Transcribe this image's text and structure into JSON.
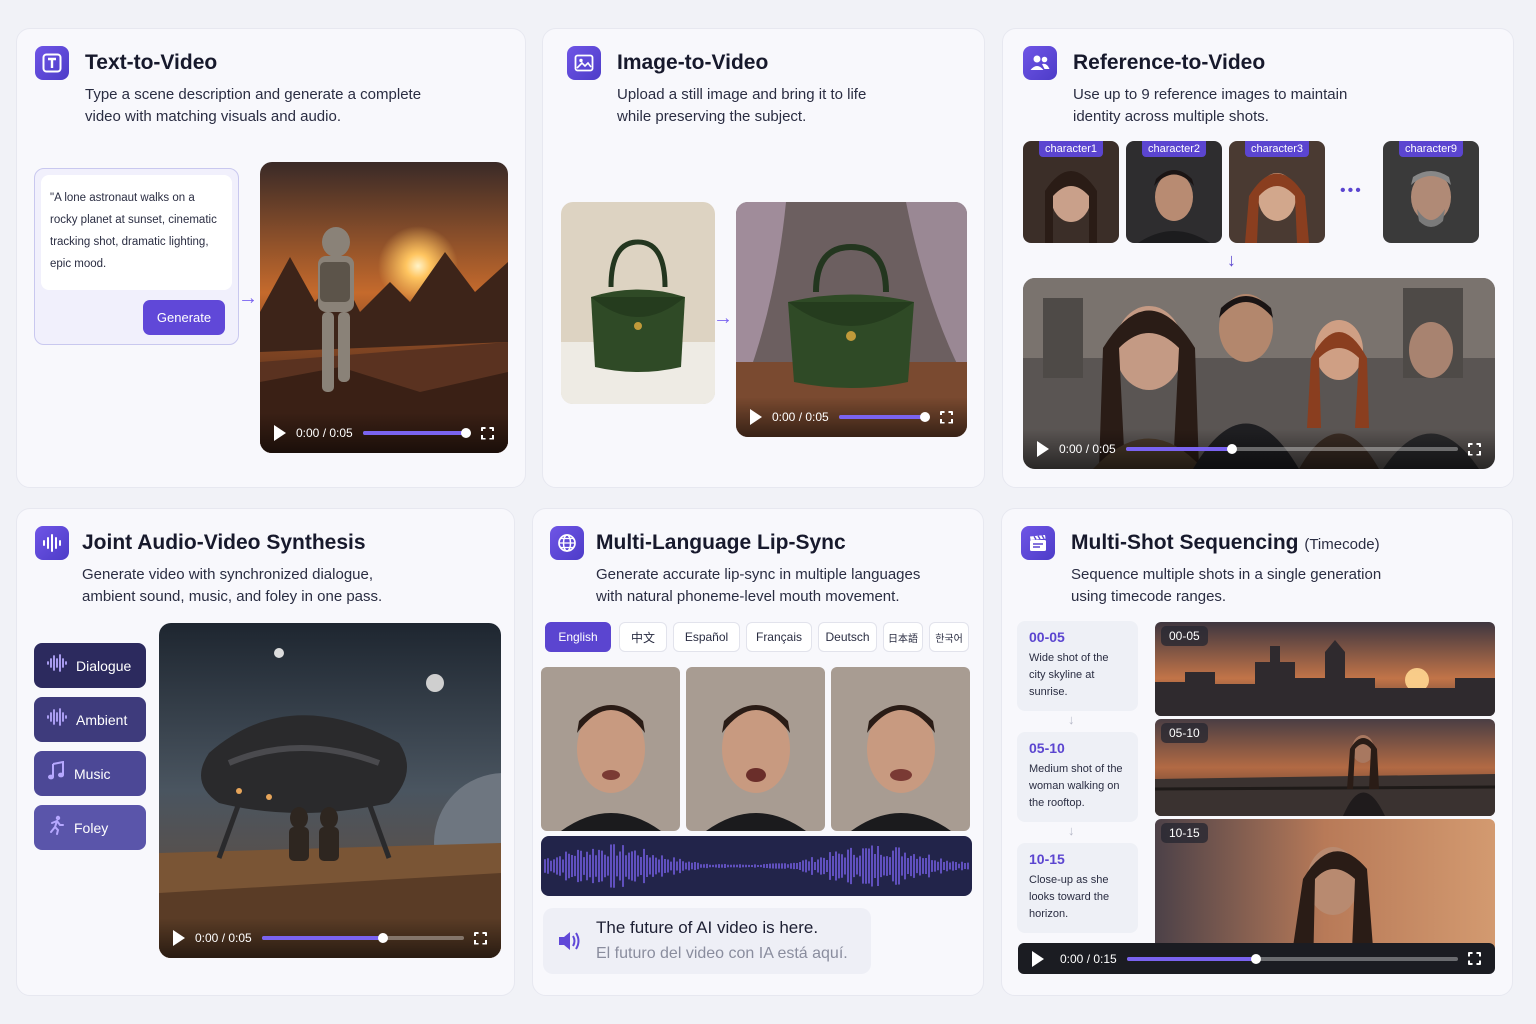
{
  "colors": {
    "accent": "#5b45d0",
    "accent_light": "#7a63f0",
    "card_bg": "#f8f8fc",
    "page_bg": "#f1f2f7"
  },
  "text_to_video": {
    "title": "Text-to-Video",
    "desc_1": "Type a scene description and generate a complete",
    "desc_2": "video with matching visuals and audio.",
    "prompt": "\"A lone astronaut walks on a rocky planet at sunset, cinematic tracking shot, dramatic lighting, epic mood.",
    "generate_label": "Generate",
    "player": {
      "time": "0:00 / 0:05",
      "progress": 0.95
    }
  },
  "image_to_video": {
    "title": "Image-to-Video",
    "desc_1": "Upload a still image and bring it to life",
    "desc_2": "while preserving the subject.",
    "player": {
      "time": "0:00 / 0:05",
      "progress": 0.95
    }
  },
  "reference_to_video": {
    "title": "Reference-to-Video",
    "desc_1": "Use up to 9 reference images to maintain",
    "desc_2": "identity across multiple shots.",
    "characters": [
      "character1",
      "character2",
      "character3",
      "character9"
    ],
    "ellipsis": "•••",
    "player": {
      "time": "0:00 / 0:05",
      "progress": 0.32
    }
  },
  "joint_audio": {
    "title": "Joint Audio-Video Synthesis",
    "desc_1": "Generate video with synchronized dialogue,",
    "desc_2": "ambient sound, music, and foley in one pass.",
    "buttons": [
      {
        "label": "Dialogue",
        "icon": "waveform-icon"
      },
      {
        "label": "Ambient",
        "icon": "waveform-icon"
      },
      {
        "label": "Music",
        "icon": "music-note-icon"
      },
      {
        "label": "Foley",
        "icon": "running-figure-icon"
      }
    ],
    "player": {
      "time": "0:00 / 0:05",
      "progress": 0.6
    }
  },
  "lip_sync": {
    "title": "Multi-Language Lip-Sync",
    "desc_1": "Generate accurate lip-sync in multiple languages",
    "desc_2": "with natural phoneme-level mouth movement.",
    "languages": [
      "English",
      "中文",
      "Español",
      "Français",
      "Deutsch",
      "日本語",
      "한국어"
    ],
    "active_language": "English",
    "line_1": "The future of AI video is here.",
    "line_2": "El futuro del video con IA está aquí."
  },
  "multi_shot": {
    "title": "Multi-Shot Sequencing",
    "title_sub": "(Timecode)",
    "desc_1": "Sequence multiple shots in a single generation",
    "desc_2": "using timecode ranges.",
    "shots": [
      {
        "tc": "00-05",
        "desc": "Wide shot of the city skyline at sunrise."
      },
      {
        "tc": "05-10",
        "desc": "Medium shot of the woman walking on the rooftop."
      },
      {
        "tc": "10-15",
        "desc": "Close-up as she looks toward the horizon."
      }
    ],
    "player": {
      "time": "0:00 / 0:15",
      "progress": 0.39
    }
  }
}
